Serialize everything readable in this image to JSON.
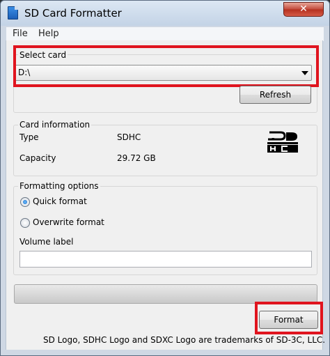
{
  "window": {
    "title": "SD Card Formatter",
    "close_glyph": "✕"
  },
  "menu": {
    "items": [
      {
        "label": "File"
      },
      {
        "label": "Help"
      }
    ]
  },
  "select_card": {
    "group_label": "Select card",
    "selected_drive": "D:\\",
    "refresh_label": "Refresh"
  },
  "card_info": {
    "group_label": "Card information",
    "type_label": "Type",
    "type_value": "SDHC",
    "capacity_label": "Capacity",
    "capacity_value": "29.72 GB",
    "logo_icon": "sdhc-logo-icon"
  },
  "formatting": {
    "group_label": "Formatting options",
    "options": [
      {
        "label": "Quick format",
        "selected": true
      },
      {
        "label": "Overwrite format",
        "selected": false
      }
    ],
    "volume_label_caption": "Volume label",
    "volume_label_value": ""
  },
  "progress": {
    "fraction": 0
  },
  "actions": {
    "format_label": "Format"
  },
  "footer": {
    "trademark_text": "SD Logo, SDHC Logo and SDXC Logo are trademarks of SD-3C, LLC."
  },
  "colors": {
    "highlight": "#e0141e",
    "titlebar": "#c3d3e6"
  }
}
